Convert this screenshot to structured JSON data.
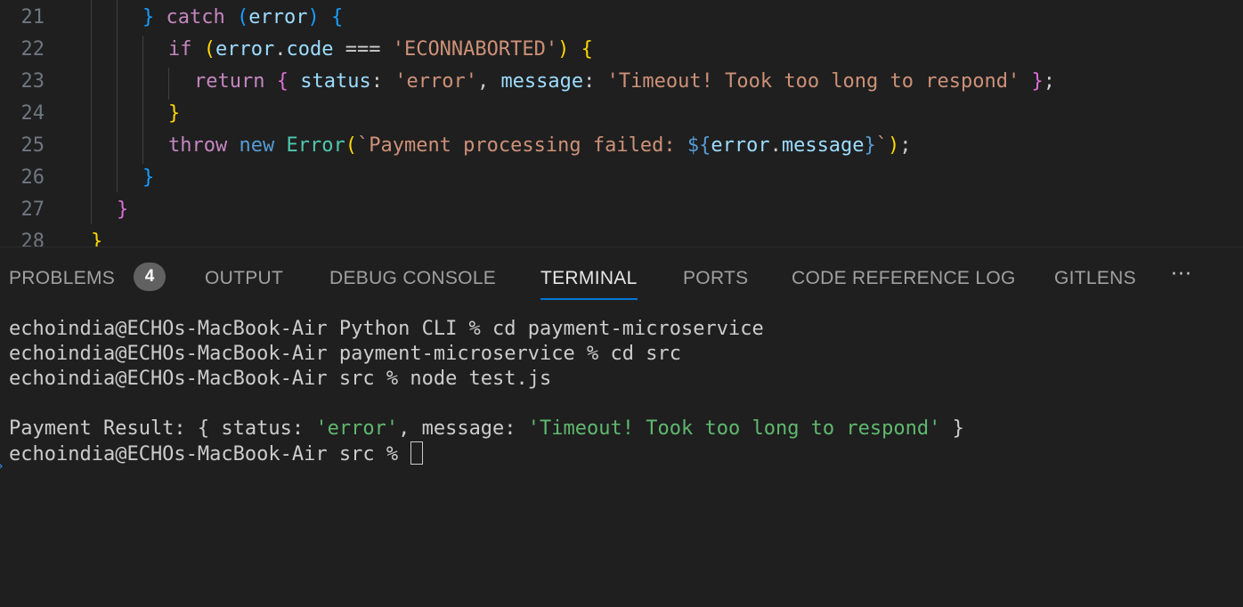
{
  "editor": {
    "lines": [
      {
        "num": "21",
        "tokens": [
          {
            "t": "} ",
            "c": "p3"
          },
          {
            "t": "catch",
            "c": "kw-ctrl"
          },
          {
            "t": " ",
            "c": "punc"
          },
          {
            "t": "(",
            "c": "p3"
          },
          {
            "t": "error",
            "c": "var"
          },
          {
            "t": ")",
            "c": "p3"
          },
          {
            "t": " ",
            "c": "punc"
          },
          {
            "t": "{",
            "c": "p3"
          }
        ]
      },
      {
        "num": "22",
        "tokens": [
          {
            "t": "if",
            "c": "kw-ctrl"
          },
          {
            "t": " ",
            "c": "punc"
          },
          {
            "t": "(",
            "c": "p1"
          },
          {
            "t": "error",
            "c": "var"
          },
          {
            "t": ".",
            "c": "punc"
          },
          {
            "t": "code",
            "c": "var"
          },
          {
            "t": " === ",
            "c": "punc"
          },
          {
            "t": "'ECONNABORTED'",
            "c": "str"
          },
          {
            "t": ")",
            "c": "p1"
          },
          {
            "t": " ",
            "c": "punc"
          },
          {
            "t": "{",
            "c": "p1"
          }
        ]
      },
      {
        "num": "23",
        "tokens": [
          {
            "t": "return",
            "c": "kw-ctrl"
          },
          {
            "t": " ",
            "c": "punc"
          },
          {
            "t": "{",
            "c": "p2"
          },
          {
            "t": " ",
            "c": "punc"
          },
          {
            "t": "status",
            "c": "var"
          },
          {
            "t": ": ",
            "c": "punc"
          },
          {
            "t": "'error'",
            "c": "str"
          },
          {
            "t": ", ",
            "c": "punc"
          },
          {
            "t": "message",
            "c": "var"
          },
          {
            "t": ": ",
            "c": "punc"
          },
          {
            "t": "'Timeout! Took too long to respond'",
            "c": "str"
          },
          {
            "t": " ",
            "c": "punc"
          },
          {
            "t": "}",
            "c": "p2"
          },
          {
            "t": ";",
            "c": "punc"
          }
        ]
      },
      {
        "num": "24",
        "tokens": [
          {
            "t": "}",
            "c": "p1"
          }
        ]
      },
      {
        "num": "25",
        "tokens": [
          {
            "t": "throw",
            "c": "kw-ctrl"
          },
          {
            "t": " ",
            "c": "punc"
          },
          {
            "t": "new",
            "c": "kw"
          },
          {
            "t": " ",
            "c": "punc"
          },
          {
            "t": "Error",
            "c": "cls"
          },
          {
            "t": "(",
            "c": "p1"
          },
          {
            "t": "`Payment processing failed: ",
            "c": "str"
          },
          {
            "t": "${",
            "c": "kw"
          },
          {
            "t": "error",
            "c": "var"
          },
          {
            "t": ".",
            "c": "punc"
          },
          {
            "t": "message",
            "c": "var"
          },
          {
            "t": "}",
            "c": "kw"
          },
          {
            "t": "`",
            "c": "str"
          },
          {
            "t": ")",
            "c": "p1"
          },
          {
            "t": ";",
            "c": "punc"
          }
        ]
      },
      {
        "num": "26",
        "tokens": [
          {
            "t": "}",
            "c": "p3"
          }
        ]
      },
      {
        "num": "27",
        "tokens": [
          {
            "t": "}",
            "c": "p2"
          }
        ]
      },
      {
        "num": "28",
        "tokens": [
          {
            "t": "}",
            "c": "p1"
          }
        ]
      }
    ]
  },
  "panel": {
    "tabs": [
      {
        "label": "PROBLEMS",
        "active": false
      },
      {
        "label": "OUTPUT",
        "active": false
      },
      {
        "label": "DEBUG CONSOLE",
        "active": false
      },
      {
        "label": "TERMINAL",
        "active": true
      },
      {
        "label": "PORTS",
        "active": false
      },
      {
        "label": "CODE REFERENCE LOG",
        "active": false
      },
      {
        "label": "GITLENS",
        "active": false
      }
    ],
    "problems_count": "4",
    "more_label": "···"
  },
  "terminal": {
    "lines": [
      "echoindia@ECHOs-MacBook-Air Python CLI % cd payment-microservice",
      "echoindia@ECHOs-MacBook-Air payment-microservice % cd src",
      "echoindia@ECHOs-MacBook-Air src % node test.js",
      ""
    ],
    "result": {
      "prefix": "Payment Result: { status: ",
      "status": "'error'",
      "mid": ", message: ",
      "message": "'Timeout! Took too long to respond'",
      "suffix": " }"
    },
    "prompt": "echoindia@ECHOs-MacBook-Air src % "
  },
  "colors": {
    "background": "#1f1f1f",
    "active_tab_underline": "#0078d4",
    "terminal_string": "#5fb96f"
  }
}
